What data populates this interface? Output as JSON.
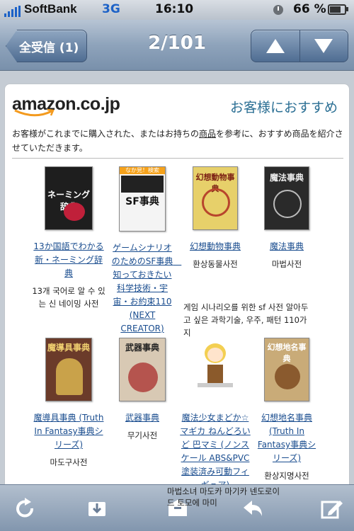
{
  "status": {
    "carrier": "SoftBank",
    "network": "3G",
    "time": "16:10",
    "battery": "66 %"
  },
  "nav": {
    "back_label": "全受信 (1)",
    "title": "2/101",
    "up_icon": "up-arrow-icon",
    "down_icon": "down-arrow-icon"
  },
  "email": {
    "logo": "amazon.co.jp",
    "header_right": "お客様におすすめ",
    "intro_before": "お客様がこれまでに購入された、またはお持ちの",
    "intro_link": "商品",
    "intro_after": "を参考に、おすすめ商品を紹介させていただきます。",
    "products": [
      {
        "title": "13か国語でわかる新・ネーミング辞典",
        "korean": "13개 국어로 알 수 있는 신 네이밍 사전",
        "cover_text": "ネーミング辞典",
        "cover_color": "#1e1e1e"
      },
      {
        "title": "ゲームシナリオのためのSF事典　知っておきたい科学技術・宇宙・お約束110 (NEXT CREATOR)",
        "korean": "게임 시나리오를 위한 sf 사전 알아두고 싶은 과학기술, 우주, 패턴 110가지",
        "cover_text": "SF事典",
        "cover_badge": "なか見！検索",
        "cover_color": "#f4f4f4"
      },
      {
        "title": "幻想動物事典",
        "korean": "환상동물사전",
        "cover_text": "幻想動物事典",
        "cover_color": "#e7d06a"
      },
      {
        "title": "魔法事典",
        "korean": "마법사전",
        "cover_text": "魔法事典",
        "cover_color": "#2a2a2a"
      },
      {
        "title": "魔導具事典 (Truth In Fantasy事典シリーズ)",
        "korean": "마도구사전",
        "cover_text": "魔導具事典",
        "cover_color": "#6b3b2a"
      },
      {
        "title": "武器事典",
        "korean": "무기사전",
        "cover_text": "武器事典",
        "cover_color": "#d8c9b4"
      },
      {
        "title": "魔法少女まどか☆マギカ ねんどろいど 巴マミ (ノンスケール ABS&PVC塗装済み可動フィギュア)",
        "korean": "마법소녀 마도카 마기카 넨도로이드 토모에 마미",
        "cover_color": "#ffffff"
      },
      {
        "title": "幻想地名事典 (Truth In Fantasy事典シリーズ)",
        "korean": "환상지명사전",
        "cover_text": "幻想地名事典",
        "cover_color": "#c9ab78"
      }
    ]
  },
  "toolbar": {
    "items": [
      "refresh-icon",
      "move-folder-icon",
      "archive-icon",
      "reply-icon",
      "compose-icon"
    ]
  },
  "colors": {
    "link": "#1a4d8f",
    "nav": "#7990ab",
    "accent": "#2b6f94"
  }
}
